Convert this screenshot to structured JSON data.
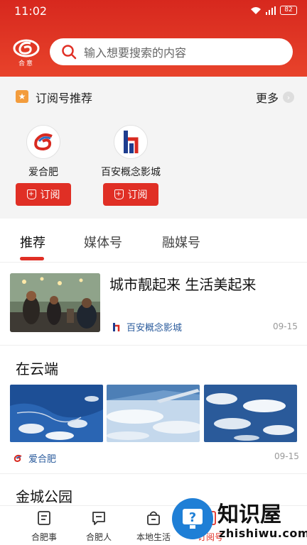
{
  "status_bar": {
    "time": "11:02",
    "battery": "82"
  },
  "header": {
    "logo_text": "合意",
    "search_placeholder": "输入想要搜索的内容"
  },
  "subscriptions": {
    "title": "订阅号推荐",
    "more_label": "更多",
    "accounts": [
      {
        "name": "爱合肥",
        "button_label": "订阅"
      },
      {
        "name": "百安概念影城",
        "button_label": "订阅"
      }
    ]
  },
  "tabs": [
    {
      "label": "推荐"
    },
    {
      "label": "媒体号"
    },
    {
      "label": "融媒号"
    }
  ],
  "articles": [
    {
      "title": "城市靓起来 生活美起来",
      "source": "百安概念影城",
      "date": "09-15"
    },
    {
      "title": "在云端",
      "source": "爱合肥",
      "date": "09-15"
    },
    {
      "title": "金城公园"
    }
  ],
  "bottom_nav": [
    {
      "label": "合肥事"
    },
    {
      "label": "合肥人"
    },
    {
      "label": "本地生活"
    },
    {
      "label": "订阅号"
    }
  ],
  "watermark": {
    "text": "知识屋",
    "url": "zhishiwu.com"
  },
  "colors": {
    "brand_red": "#e02f25",
    "source_blue": "#2a5b9c"
  }
}
